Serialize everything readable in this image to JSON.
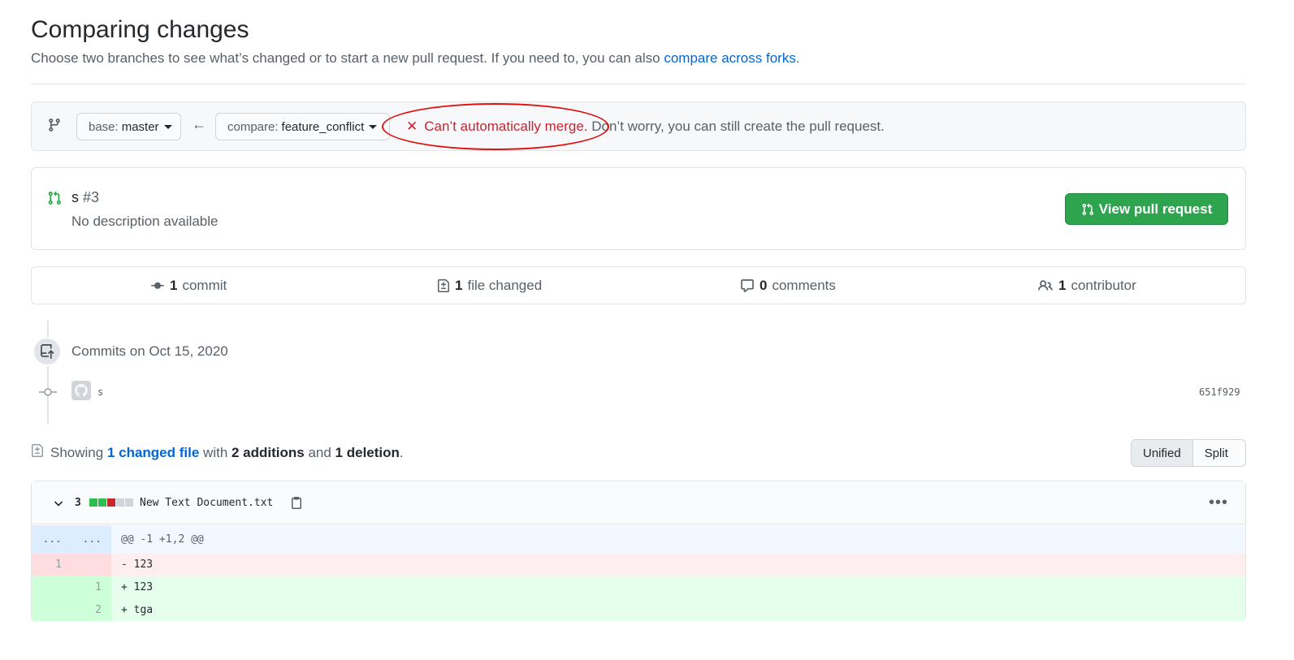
{
  "header": {
    "title": "Comparing changes",
    "subtitle_prefix": "Choose two branches to see what’s changed or to start a new pull request. If you need to, you can also ",
    "subtitle_link": "compare across forks",
    "subtitle_suffix": "."
  },
  "range": {
    "base_label": "base:",
    "base_value": "master",
    "compare_label": "compare:",
    "compare_value": "feature_conflict",
    "merge_error": "Can’t automatically merge.",
    "merge_hint": " Don’t worry, you can still create the pull request."
  },
  "existing_pr": {
    "title": "s",
    "number": "#3",
    "description": "No description available",
    "button_label": "View pull request"
  },
  "summary": {
    "commits_count": "1",
    "commits_label": "commit",
    "files_count": "1",
    "files_label": "file changed",
    "comments_count": "0",
    "comments_label": "comments",
    "contributors_count": "1",
    "contributors_label": "contributor"
  },
  "commits": {
    "date_heading": "Commits on Oct 15, 2020",
    "items": [
      {
        "message": "s",
        "sha": "651f929"
      }
    ]
  },
  "toc": {
    "prefix": "Showing ",
    "link": "1 changed file",
    "middle": " with ",
    "additions": "2 additions",
    "and": " and ",
    "deletions": "1 deletion",
    "suffix": ".",
    "view_unified": "Unified",
    "view_split": "Split"
  },
  "file": {
    "changes": "3",
    "name": "New Text Document.txt",
    "hunk": {
      "old": "...",
      "new": "...",
      "text": "@@ -1 +1,2 @@"
    },
    "lines": [
      {
        "old": "1",
        "new": "",
        "text": "- 123"
      },
      {
        "old": "",
        "new": "1",
        "text": "+ 123"
      },
      {
        "old": "",
        "new": "2",
        "text": "+ tga"
      }
    ]
  },
  "colors": {
    "link": "#0366d6",
    "error": "#cb2431",
    "success_button": "#2ea44f",
    "annotation": "#e01010"
  }
}
